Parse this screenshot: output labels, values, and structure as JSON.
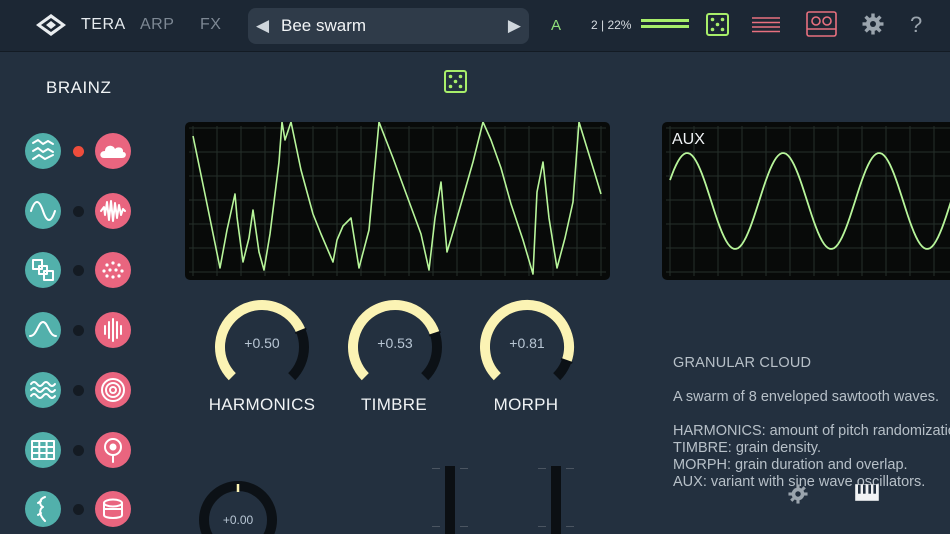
{
  "header": {
    "tabs": [
      {
        "label": "TERA",
        "active": true
      },
      {
        "label": "ARP",
        "active": false
      },
      {
        "label": "FX",
        "active": false
      }
    ],
    "preset": {
      "prev_glyph": "◀",
      "name": "Bee swarm",
      "next_glyph": "▶"
    },
    "bank": "A",
    "voice_cpu": "2 | 22%",
    "icons": [
      "logo-icon",
      "dice-icon",
      "sequencer-lines-icon",
      "recorder-icon",
      "gear-icon",
      "help-icon"
    ],
    "help_glyph": "?"
  },
  "brainz": {
    "title": "BRAINZ",
    "rows": [
      {
        "left_icon": "shape-morph-icon",
        "right_icon": "cloud-icon",
        "led_on": true
      },
      {
        "left_icon": "sine-icon",
        "right_icon": "noise-burst-icon",
        "led_on": false
      },
      {
        "left_icon": "blocks-icon",
        "right_icon": "particles-icon",
        "led_on": false
      },
      {
        "left_icon": "bell-curve-icon",
        "right_icon": "pulse-bars-icon",
        "led_on": false
      },
      {
        "left_icon": "waves-icon",
        "right_icon": "rings-icon",
        "led_on": false
      },
      {
        "left_icon": "grid-icon",
        "right_icon": "drum-head-icon",
        "led_on": false
      },
      {
        "left_icon": "speech-icon",
        "right_icon": "drum-icon",
        "led_on": false
      }
    ]
  },
  "main_display": {
    "waveform": "sawtooth-swarm"
  },
  "aux_display": {
    "label": "AUX",
    "waveform": "sine"
  },
  "knobs": [
    {
      "name": "HARMONICS",
      "value": "+0.50",
      "fraction": 0.75
    },
    {
      "name": "TIMBRE",
      "value": "+0.53",
      "fraction": 0.765
    },
    {
      "name": "MORPH",
      "value": "+0.81",
      "fraction": 0.905
    }
  ],
  "small_knob": {
    "value": "+0.00"
  },
  "info": {
    "title": "GRANULAR CLOUD",
    "description": "A swarm of 8 enveloped sawtooth waves.",
    "lines": [
      "HARMONICS:  amount of pitch randomization.",
      "TIMBRE:  grain density.",
      "MORPH:  grain duration and overlap.",
      "AUX:  variant with sine wave oscillators."
    ]
  },
  "colors": {
    "background": "#23303f",
    "topbar": "#1c2734",
    "accent_green": "#a8ee6a",
    "trace": "#b7f59a",
    "knob_arc": "#fbf3b4",
    "teal": "#52b0ab",
    "pink": "#e9657f",
    "led_on": "#ee4d3c"
  }
}
